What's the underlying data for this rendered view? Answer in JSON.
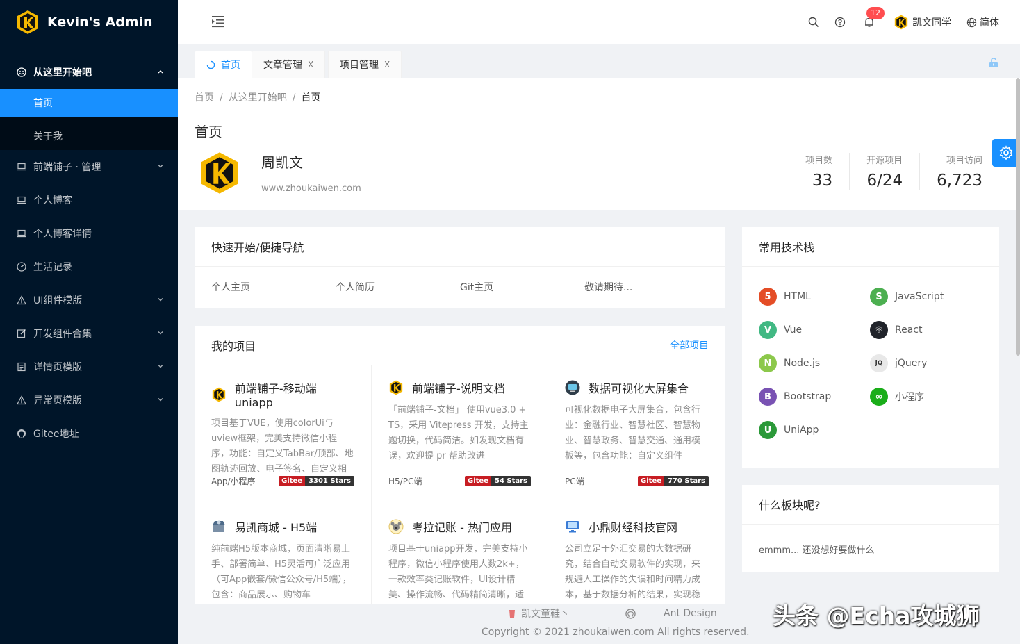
{
  "app": {
    "title": "Kevin's Admin"
  },
  "sidebar": {
    "group_open": {
      "label": "从这里开始吧",
      "icon": "smile-icon"
    },
    "sub_items": [
      {
        "label": "首页",
        "active": true
      },
      {
        "label": "关于我",
        "active": false
      }
    ],
    "items": [
      {
        "label": "前端铺子 · 管理",
        "icon": "laptop-icon",
        "has_arrow": true
      },
      {
        "label": "个人博客",
        "icon": "laptop-icon",
        "has_arrow": false
      },
      {
        "label": "个人博客详情",
        "icon": "laptop-icon",
        "has_arrow": false
      },
      {
        "label": "生活记录",
        "icon": "dashboard-icon",
        "has_arrow": false
      },
      {
        "label": "UI组件模版",
        "icon": "warning-icon",
        "has_arrow": true
      },
      {
        "label": "开发组件合集",
        "icon": "edit-icon",
        "has_arrow": true
      },
      {
        "label": "详情页模版",
        "icon": "profile-icon",
        "has_arrow": true
      },
      {
        "label": "异常页模版",
        "icon": "warning-icon",
        "has_arrow": true
      },
      {
        "label": "Gitee地址",
        "icon": "github-icon",
        "has_arrow": false
      }
    ]
  },
  "header": {
    "notification_count": "12",
    "user_name": "凯文同学",
    "language": "简体"
  },
  "tabs": [
    {
      "label": "首页",
      "active": true
    },
    {
      "label": "文章管理",
      "close": "X"
    },
    {
      "label": "项目管理",
      "close": "X"
    }
  ],
  "breadcrumb": [
    "首页",
    "从这里开始吧",
    "首页"
  ],
  "breadcrumb_sep": "/",
  "page_title": "首页",
  "profile": {
    "name": "周凯文",
    "site": "www.zhoukaiwen.com"
  },
  "stats": [
    {
      "label": "项目数",
      "value": "33"
    },
    {
      "label": "开源项目",
      "value": "6/24"
    },
    {
      "label": "项目访问",
      "value": "6,723"
    }
  ],
  "quick_nav": {
    "title": "快速开始/便捷导航",
    "links": [
      "个人主页",
      "个人简历",
      "Git主页",
      "敬请期待..."
    ]
  },
  "projects_card": {
    "title": "我的项目",
    "extra": "全部项目",
    "projects": [
      {
        "title": "前端铺子-移动端uniapp",
        "icon": "kevin-logo-icon",
        "desc": "项目基于VUE，使用colorUi与uview框架，完美支持微信小程序，功能：自定义TabBar/顶部、地图轨迹回放、电子签名、自定义相机",
        "type": "App/小程序",
        "badge_left": "Gitee",
        "badge_right": "3301 Stars"
      },
      {
        "title": "前端铺子-说明文档",
        "icon": "kevin-logo-icon",
        "desc": "「前端铺子-文档」 使用vue3.0 + TS，采用 Vitepress 开发，支持主题切换，代码简洁。如发现文档有误，欢迎提 pr 帮助改进",
        "type": "H5/PC端",
        "badge_left": "Gitee",
        "badge_right": "54 Stars"
      },
      {
        "title": "数据可视化大屏集合",
        "icon": "monitor-icon",
        "desc": "可视化数据电子大屏集合，包含行业：金融行业、智慧社区、智慧物业、智慧政务、智慧交通、通用模板等，包含功能：自定义组件",
        "type": "PC端",
        "badge_left": "Gitee",
        "badge_right": "770 Stars"
      },
      {
        "title": "易凯商城 - H5端",
        "icon": "shop-icon",
        "desc": "纯前端H5版本商城，页面清晰易上手、部署简单、H5灵活可广泛应用（可App嵌套/微信公众号/H5端），包含：商品展示、购物车",
        "type": "",
        "badge_left": "",
        "badge_right": ""
      },
      {
        "title": "考拉记账 - 热门应用",
        "icon": "koala-icon",
        "desc": "项目基于uniapp开发，完美支持小程序，微信小程序使用人数2k+，一款效率类记账软件，UI设计精美、操作流畅、代码精简清晰，适合学习",
        "type": "",
        "badge_left": "",
        "badge_right": ""
      },
      {
        "title": "小鼎财经科技官网",
        "icon": "desktop-icon",
        "desc": "公司立足于外汇交易的大数据研究，结合自动交易软件的实现，来规避人工操作的失误和时间精力成本，基于数据分析的结果，实现稳定盈利",
        "type": "",
        "badge_left": "",
        "badge_right": ""
      }
    ]
  },
  "tech_card": {
    "title": "常用技术栈",
    "items": [
      {
        "label": "HTML",
        "icon": "html5-icon",
        "color": "#e44d26",
        "glyph": "5"
      },
      {
        "label": "JavaScript",
        "icon": "javascript-icon",
        "color": "#4caf50",
        "glyph": "S"
      },
      {
        "label": "Vue",
        "icon": "vue-icon",
        "color": "#41b883",
        "glyph": "V"
      },
      {
        "label": "React",
        "icon": "react-icon",
        "color": "#20232a",
        "glyph": "⚛"
      },
      {
        "label": "Node.js",
        "icon": "nodejs-icon",
        "color": "#8cc84b",
        "glyph": "N"
      },
      {
        "label": "jQuery",
        "icon": "jquery-icon",
        "color": "#e8e8e8",
        "glyph": "jQ"
      },
      {
        "label": "Bootstrap",
        "icon": "bootstrap-icon",
        "color": "#7952b3",
        "glyph": "B"
      },
      {
        "label": "小程序",
        "icon": "miniprogram-icon",
        "color": "#1aad19",
        "glyph": "∞"
      },
      {
        "label": "UniApp",
        "icon": "uniapp-icon",
        "color": "#2b9939",
        "glyph": "U"
      }
    ]
  },
  "what_card": {
    "title": "什么板块呢?",
    "body": "emmm... 还没想好要做什么"
  },
  "footer": {
    "links": [
      "凯文童鞋丶",
      "",
      "Ant Design"
    ],
    "copyright": "Copyright © 2021 zhoukaiwen.com All rights reserved."
  },
  "watermark": "头条 @Echa攻城狮",
  "colors": {
    "sidebar_bg": "#001529",
    "accent": "#1890ff"
  }
}
